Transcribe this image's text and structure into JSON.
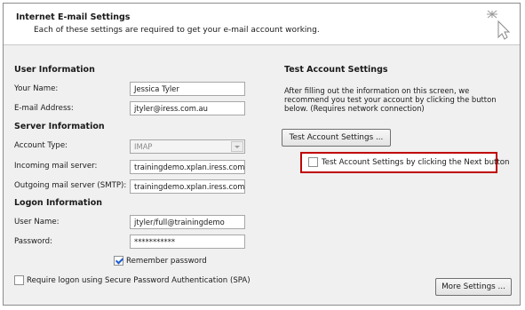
{
  "header": {
    "title": "Internet E-mail Settings",
    "subtitle": "Each of these settings are required to get your e-mail account working.",
    "icon": "sparkle-cursor-icon"
  },
  "user_information": {
    "heading": "User Information",
    "your_name_label": "Your Name:",
    "your_name_value": "Jessica Tyler",
    "email_label": "E-mail Address:",
    "email_value": "jtyler@iress.com.au"
  },
  "server_information": {
    "heading": "Server Information",
    "account_type_label": "Account Type:",
    "account_type_value": "IMAP",
    "incoming_label": "Incoming mail server:",
    "incoming_value": "trainingdemo.xplan.iress.com.",
    "outgoing_label": "Outgoing mail server (SMTP):",
    "outgoing_value": "trainingdemo.xplan.iress.com."
  },
  "logon_information": {
    "heading": "Logon Information",
    "username_label": "User Name:",
    "username_value": "jtyler/full@trainingdemo",
    "password_label": "Password:",
    "password_value": "***********",
    "remember_password_label": "Remember password",
    "remember_password_checked": true,
    "spa_label": "Require logon using Secure Password Authentication (SPA)",
    "spa_checked": false
  },
  "test_account": {
    "heading": "Test Account Settings",
    "description": "After filling out the information on this screen, we recommend you test your account by clicking the button below. (Requires network connection)",
    "test_button_label": "Test Account Settings ...",
    "test_on_next_label": "Test Account Settings by clicking the Next button",
    "test_on_next_checked": false,
    "highlight_color": "#c00000"
  },
  "footer": {
    "more_settings_label": "More Settings ..."
  }
}
